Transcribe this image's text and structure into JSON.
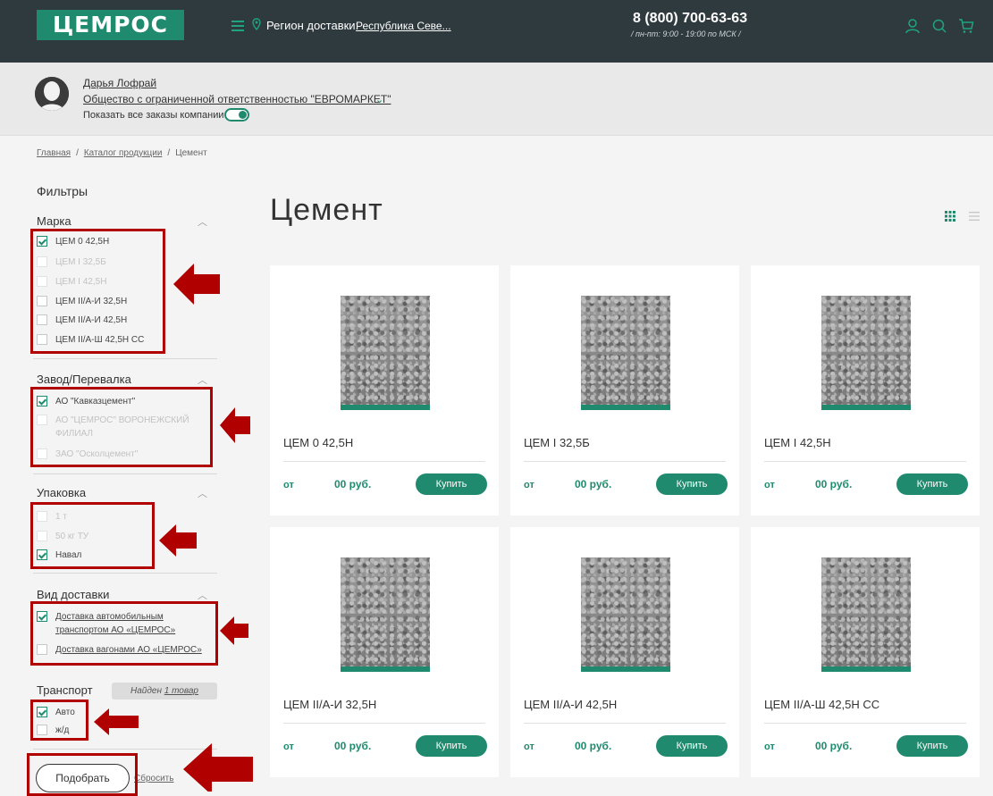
{
  "header": {
    "logo": "ЦЕМРОС",
    "region_label": "Регион доставки:",
    "region_value": "Республика Севе...",
    "phone": "8 (800) 700-63-63",
    "hours": "/ пн-пт: 9:00 - 19:00 по МСК /",
    "icons": [
      "menu-icon",
      "location-pin-icon",
      "user-icon",
      "search-icon",
      "cart-icon"
    ]
  },
  "user": {
    "name": "Дарья Лофрай",
    "company": "Общество с ограниченной ответственностью \"ЕВРОМАРКЕТ\"",
    "show_all_label": "Показать все заказы компании",
    "show_all_on": true
  },
  "breadcrumb": [
    "Главная",
    "Каталог продукции",
    "Цемент"
  ],
  "filters": {
    "title": "Фильтры",
    "groups": [
      {
        "title": "Марка",
        "options": [
          {
            "label": "ЦЕМ 0 42,5Н",
            "checked": true,
            "disabled": false
          },
          {
            "label": "ЦЕМ I 32,5Б",
            "checked": false,
            "disabled": true
          },
          {
            "label": "ЦЕМ I 42,5Н",
            "checked": false,
            "disabled": true
          },
          {
            "label": "ЦЕМ II/А-И 32,5Н",
            "checked": false,
            "disabled": false
          },
          {
            "label": "ЦЕМ II/А-И 42,5Н",
            "checked": false,
            "disabled": false
          },
          {
            "label": "ЦЕМ II/А-Ш 42,5Н СС",
            "checked": false,
            "disabled": false
          }
        ]
      },
      {
        "title": "Завод/Перевалка",
        "options": [
          {
            "label": "АО \"Кавказцемент\"",
            "checked": true,
            "disabled": false
          },
          {
            "label": "АО \"ЦЕМРОС\" ВОРОНЕЖСКИЙ",
            "label2": "ФИЛИАЛ",
            "checked": false,
            "disabled": true
          },
          {
            "label": "ЗАО \"Осколцемент\"",
            "checked": false,
            "disabled": true
          }
        ]
      },
      {
        "title": "Упаковка",
        "options": [
          {
            "label": "1 т",
            "checked": false,
            "disabled": true
          },
          {
            "label": "50 кг ТУ",
            "checked": false,
            "disabled": true
          },
          {
            "label": "Навал",
            "checked": true,
            "disabled": false
          }
        ]
      },
      {
        "title": "Вид доставки",
        "options": [
          {
            "label": "Доставка автомобильным",
            "label2": "транспортом АО «ЦЕМРОС»",
            "checked": true,
            "disabled": false
          },
          {
            "label": "Доставка вагонами АО «ЦЕМРОС»",
            "checked": false,
            "disabled": false
          }
        ]
      },
      {
        "title": "Транспорт",
        "options": [
          {
            "label": "Авто",
            "checked": true,
            "disabled": false
          },
          {
            "label": "ж/д",
            "checked": false,
            "disabled": false
          }
        ]
      }
    ],
    "found_prefix": "Найден",
    "found_count": "1 товар",
    "select_label": "Подобрать",
    "reset_label": "Сбросить"
  },
  "main": {
    "title": "Цемент",
    "view_modes": [
      "grid-view-icon",
      "list-view-icon"
    ],
    "products": [
      {
        "name": "ЦЕМ 0 42,5Н",
        "from": "от",
        "price": "00 руб.",
        "buy": "Купить"
      },
      {
        "name": "ЦЕМ I 32,5Б",
        "from": "от",
        "price": "00 руб.",
        "buy": "Купить"
      },
      {
        "name": "ЦЕМ I 42,5Н",
        "from": "от",
        "price": "00 руб.",
        "buy": "Купить"
      },
      {
        "name": "ЦЕМ II/А-И 32,5Н",
        "from": "от",
        "price": "00 руб.",
        "buy": "Купить"
      },
      {
        "name": "ЦЕМ II/А-И 42,5Н",
        "from": "от",
        "price": "00 руб.",
        "buy": "Купить"
      },
      {
        "name": "ЦЕМ II/А-Ш 42,5Н СС",
        "from": "от",
        "price": "00 руб.",
        "buy": "Купить"
      }
    ]
  },
  "colors": {
    "brand_green": "#1f8a6e",
    "header_bg": "#2f3a3f",
    "annotation_red": "#b00000"
  }
}
